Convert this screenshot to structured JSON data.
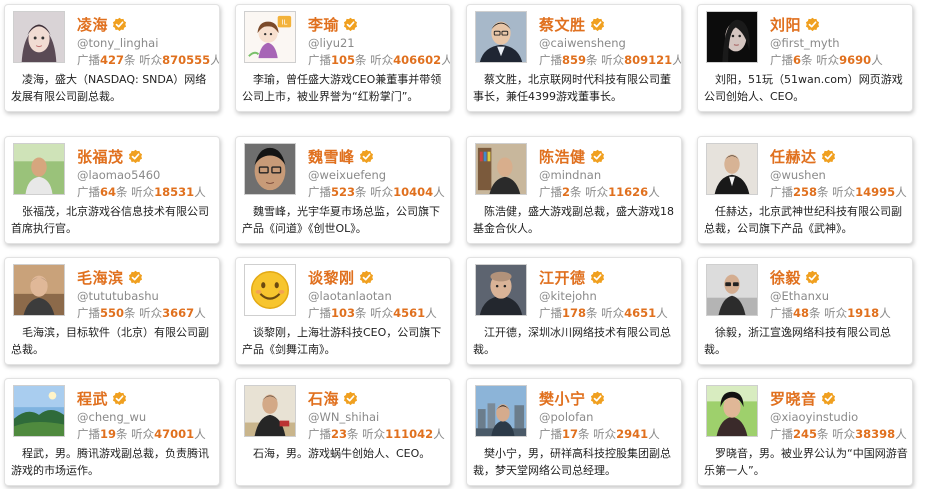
{
  "labels": {
    "broadcast": "广播",
    "count_unit": "条",
    "listeners": "听众",
    "person_unit": "人"
  },
  "colors": {
    "accent": "#e0701e",
    "verified_badge": "#f0a020",
    "muted_text": "#8a8a8a"
  },
  "cards": [
    {
      "name": "凌海",
      "handle": "@tony_linghai",
      "broadcasts": "427",
      "listeners": "870555",
      "bio": "凌海，盛大（NASDAQ: SNDA）网络发展有限公司副总裁。",
      "avatar": "woman-portrait"
    },
    {
      "name": "李瑜",
      "handle": "@liyu21",
      "broadcasts": "105",
      "listeners": "406602",
      "bio": "李瑜，曾任盛大游戏CEO兼董事并带领公司上市，被业界誉为“红粉掌门”。",
      "avatar": "cartoon-girl"
    },
    {
      "name": "蔡文胜",
      "handle": "@caiwensheng",
      "broadcasts": "859",
      "listeners": "809121",
      "bio": "蔡文胜，北京联网时代科技有限公司董事长，兼任4399游戏董事长。",
      "avatar": "man-suit"
    },
    {
      "name": "刘阳",
      "handle": "@first_myth",
      "broadcasts": "6",
      "listeners": "9690",
      "bio": "刘阳，51玩（51wan.com）网页游戏公司创始人、CEO。",
      "avatar": "dark-portrait"
    },
    {
      "name": "张福茂",
      "handle": "@laomao5460",
      "broadcasts": "64",
      "listeners": "18531",
      "bio": "张福茂，北京游戏谷信息技术有限公司首席执行官。",
      "avatar": "man-outdoor"
    },
    {
      "name": "魏雪峰",
      "handle": "@weixuefeng",
      "broadcasts": "523",
      "listeners": "10404",
      "bio": "魏雪峰，光宇华夏市场总监，公司旗下产品《问道》《创世OL》。",
      "avatar": "man-closeup"
    },
    {
      "name": "陈浩健",
      "handle": "@mindnan",
      "broadcasts": "2",
      "listeners": "11626",
      "bio": "陈浩健，盛大游戏副总裁，盛大游戏18基金合伙人。",
      "avatar": "man-bookshelf"
    },
    {
      "name": "任赫达",
      "handle": "@wushen",
      "broadcasts": "258",
      "listeners": "14995",
      "bio": "任赫达，北京武神世纪科技有限公司副总裁，公司旗下产品《武神》。",
      "avatar": "man-dark-suit"
    },
    {
      "name": "毛海滨",
      "handle": "@tututubashu",
      "broadcasts": "550",
      "listeners": "3667",
      "bio": "毛海滨，目标软件（北京）有限公司副总裁。",
      "avatar": "man-wall"
    },
    {
      "name": "谈黎刚",
      "handle": "@laotanlaotan",
      "broadcasts": "103",
      "listeners": "4561",
      "bio": "谈黎刚，上海壮游科技CEO，公司旗下产品《剑舞江南》。",
      "avatar": "smiley"
    },
    {
      "name": "江开德",
      "handle": "@kitejohn",
      "broadcasts": "178",
      "listeners": "4651",
      "bio": "江开德，深圳冰川网络技术有限公司总裁。",
      "avatar": "man-shaved"
    },
    {
      "name": "徐毅",
      "handle": "@Ethanxu",
      "broadcasts": "48",
      "listeners": "1918",
      "bio": "徐毅，浙江宣逸网络科技有限公司总裁。",
      "avatar": "man-glasses"
    },
    {
      "name": "程武",
      "handle": "@cheng_wu",
      "broadcasts": "19",
      "listeners": "47001",
      "bio": "程武，男。腾讯游戏副总裁，负责腾讯游戏的市场运作。",
      "avatar": "landscape"
    },
    {
      "name": "石海",
      "handle": "@WN_shihai",
      "broadcasts": "23",
      "listeners": "111042",
      "bio": "石海，男。游戏蜗牛创始人、CEO。",
      "avatar": "man-dining"
    },
    {
      "name": "樊小宁",
      "handle": "@polofan",
      "broadcasts": "17",
      "listeners": "2941",
      "bio": "樊小宁，男，研祥高科技控股集团副总裁，梦天堂网络公司总经理。",
      "avatar": "man-city"
    },
    {
      "name": "罗晓音",
      "handle": "@xiaoyinstudio",
      "broadcasts": "245",
      "listeners": "38398",
      "bio": "罗晓音，男。被业界公认为“中国网游音乐第一人”。",
      "avatar": "man-green"
    }
  ]
}
